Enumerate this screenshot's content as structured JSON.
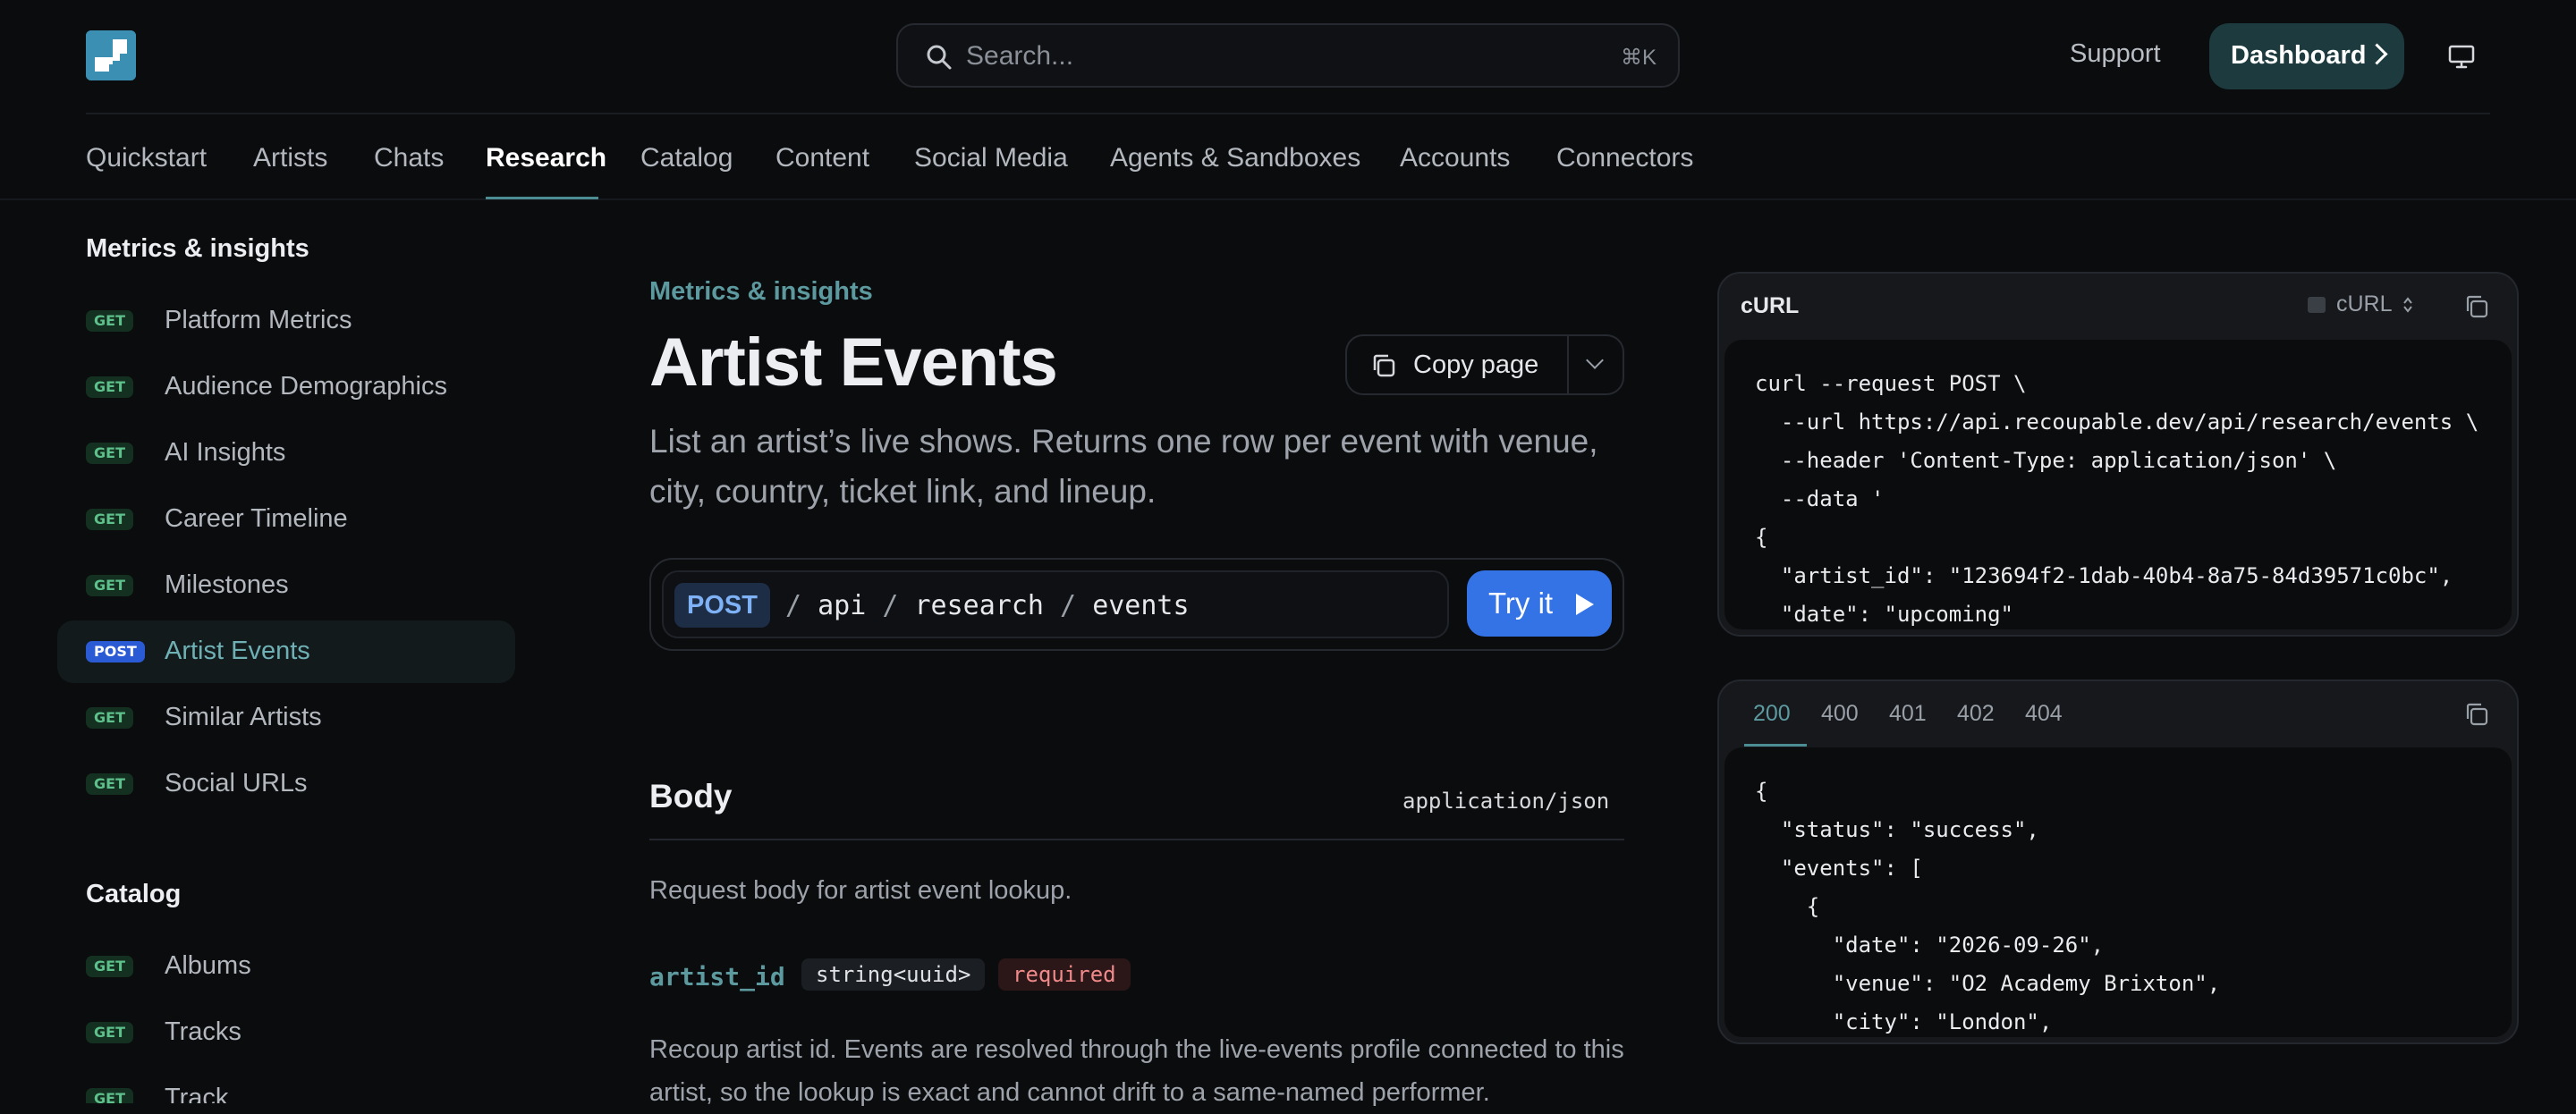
{
  "header": {
    "search_placeholder": "Search...",
    "search_shortcut": "⌘K",
    "support_label": "Support",
    "dashboard_label": "Dashboard"
  },
  "nav_tabs": [
    {
      "label": "Quickstart"
    },
    {
      "label": "Artists"
    },
    {
      "label": "Chats"
    },
    {
      "label": "Research",
      "active": true
    },
    {
      "label": "Catalog"
    },
    {
      "label": "Content"
    },
    {
      "label": "Social Media"
    },
    {
      "label": "Agents & Sandboxes"
    },
    {
      "label": "Accounts"
    },
    {
      "label": "Connectors"
    }
  ],
  "sidebar": {
    "sections": [
      {
        "title": "Metrics & insights",
        "items": [
          {
            "method": "GET",
            "label": "Platform Metrics"
          },
          {
            "method": "GET",
            "label": "Audience Demographics"
          },
          {
            "method": "GET",
            "label": "AI Insights"
          },
          {
            "method": "GET",
            "label": "Career Timeline"
          },
          {
            "method": "GET",
            "label": "Milestones"
          },
          {
            "method": "POST",
            "label": "Artist Events",
            "active": true
          },
          {
            "method": "GET",
            "label": "Similar Artists"
          },
          {
            "method": "GET",
            "label": "Social URLs"
          }
        ]
      },
      {
        "title": "Catalog",
        "items": [
          {
            "method": "GET",
            "label": "Albums"
          },
          {
            "method": "GET",
            "label": "Tracks"
          },
          {
            "method": "GET",
            "label": "Track"
          }
        ]
      }
    ]
  },
  "page": {
    "eyebrow": "Metrics & insights",
    "title": "Artist Events",
    "copy_label": "Copy page",
    "description": "List an artist’s live shows. Returns one row per event with venue, city, country, ticket link, and lineup.",
    "endpoint": {
      "method": "POST",
      "segments": [
        "api",
        "research",
        "events"
      ],
      "try_label": "Try it"
    },
    "body": {
      "heading": "Body",
      "content_type": "application/json",
      "description": "Request body for artist event lookup.",
      "param": {
        "name": "artist_id",
        "type": "string<uuid>",
        "required_label": "required",
        "description": "Recoup artist id. Events are resolved through the live-events profile connected to this artist, so the lookup is exact and cannot drift to a same-named performer."
      }
    }
  },
  "request_panel": {
    "title": "cURL",
    "language": "cURL",
    "code": "curl --request POST \\\n  --url https://api.recoupable.dev/api/research/events \\\n  --header 'Content-Type: application/json' \\\n  --data '\n{\n  \"artist_id\": \"123694f2-1dab-40b4-8a75-84d39571c0bc\",\n  \"date\": \"upcoming\""
  },
  "response_panel": {
    "tabs": [
      "200",
      "400",
      "401",
      "402",
      "404"
    ],
    "active_tab": "200",
    "code": "{\n  \"status\": \"success\",\n  \"events\": [\n    {\n      \"date\": \"2026-09-26\",\n      \"venue\": \"O2 Academy Brixton\",\n      \"city\": \"London\","
  },
  "colors": {
    "accent": "#5d9aa0",
    "primary_button": "#3473e6",
    "get_badge": "#5ec08a",
    "post_badge": "#2b5bd4",
    "required": "#f08a8a"
  }
}
